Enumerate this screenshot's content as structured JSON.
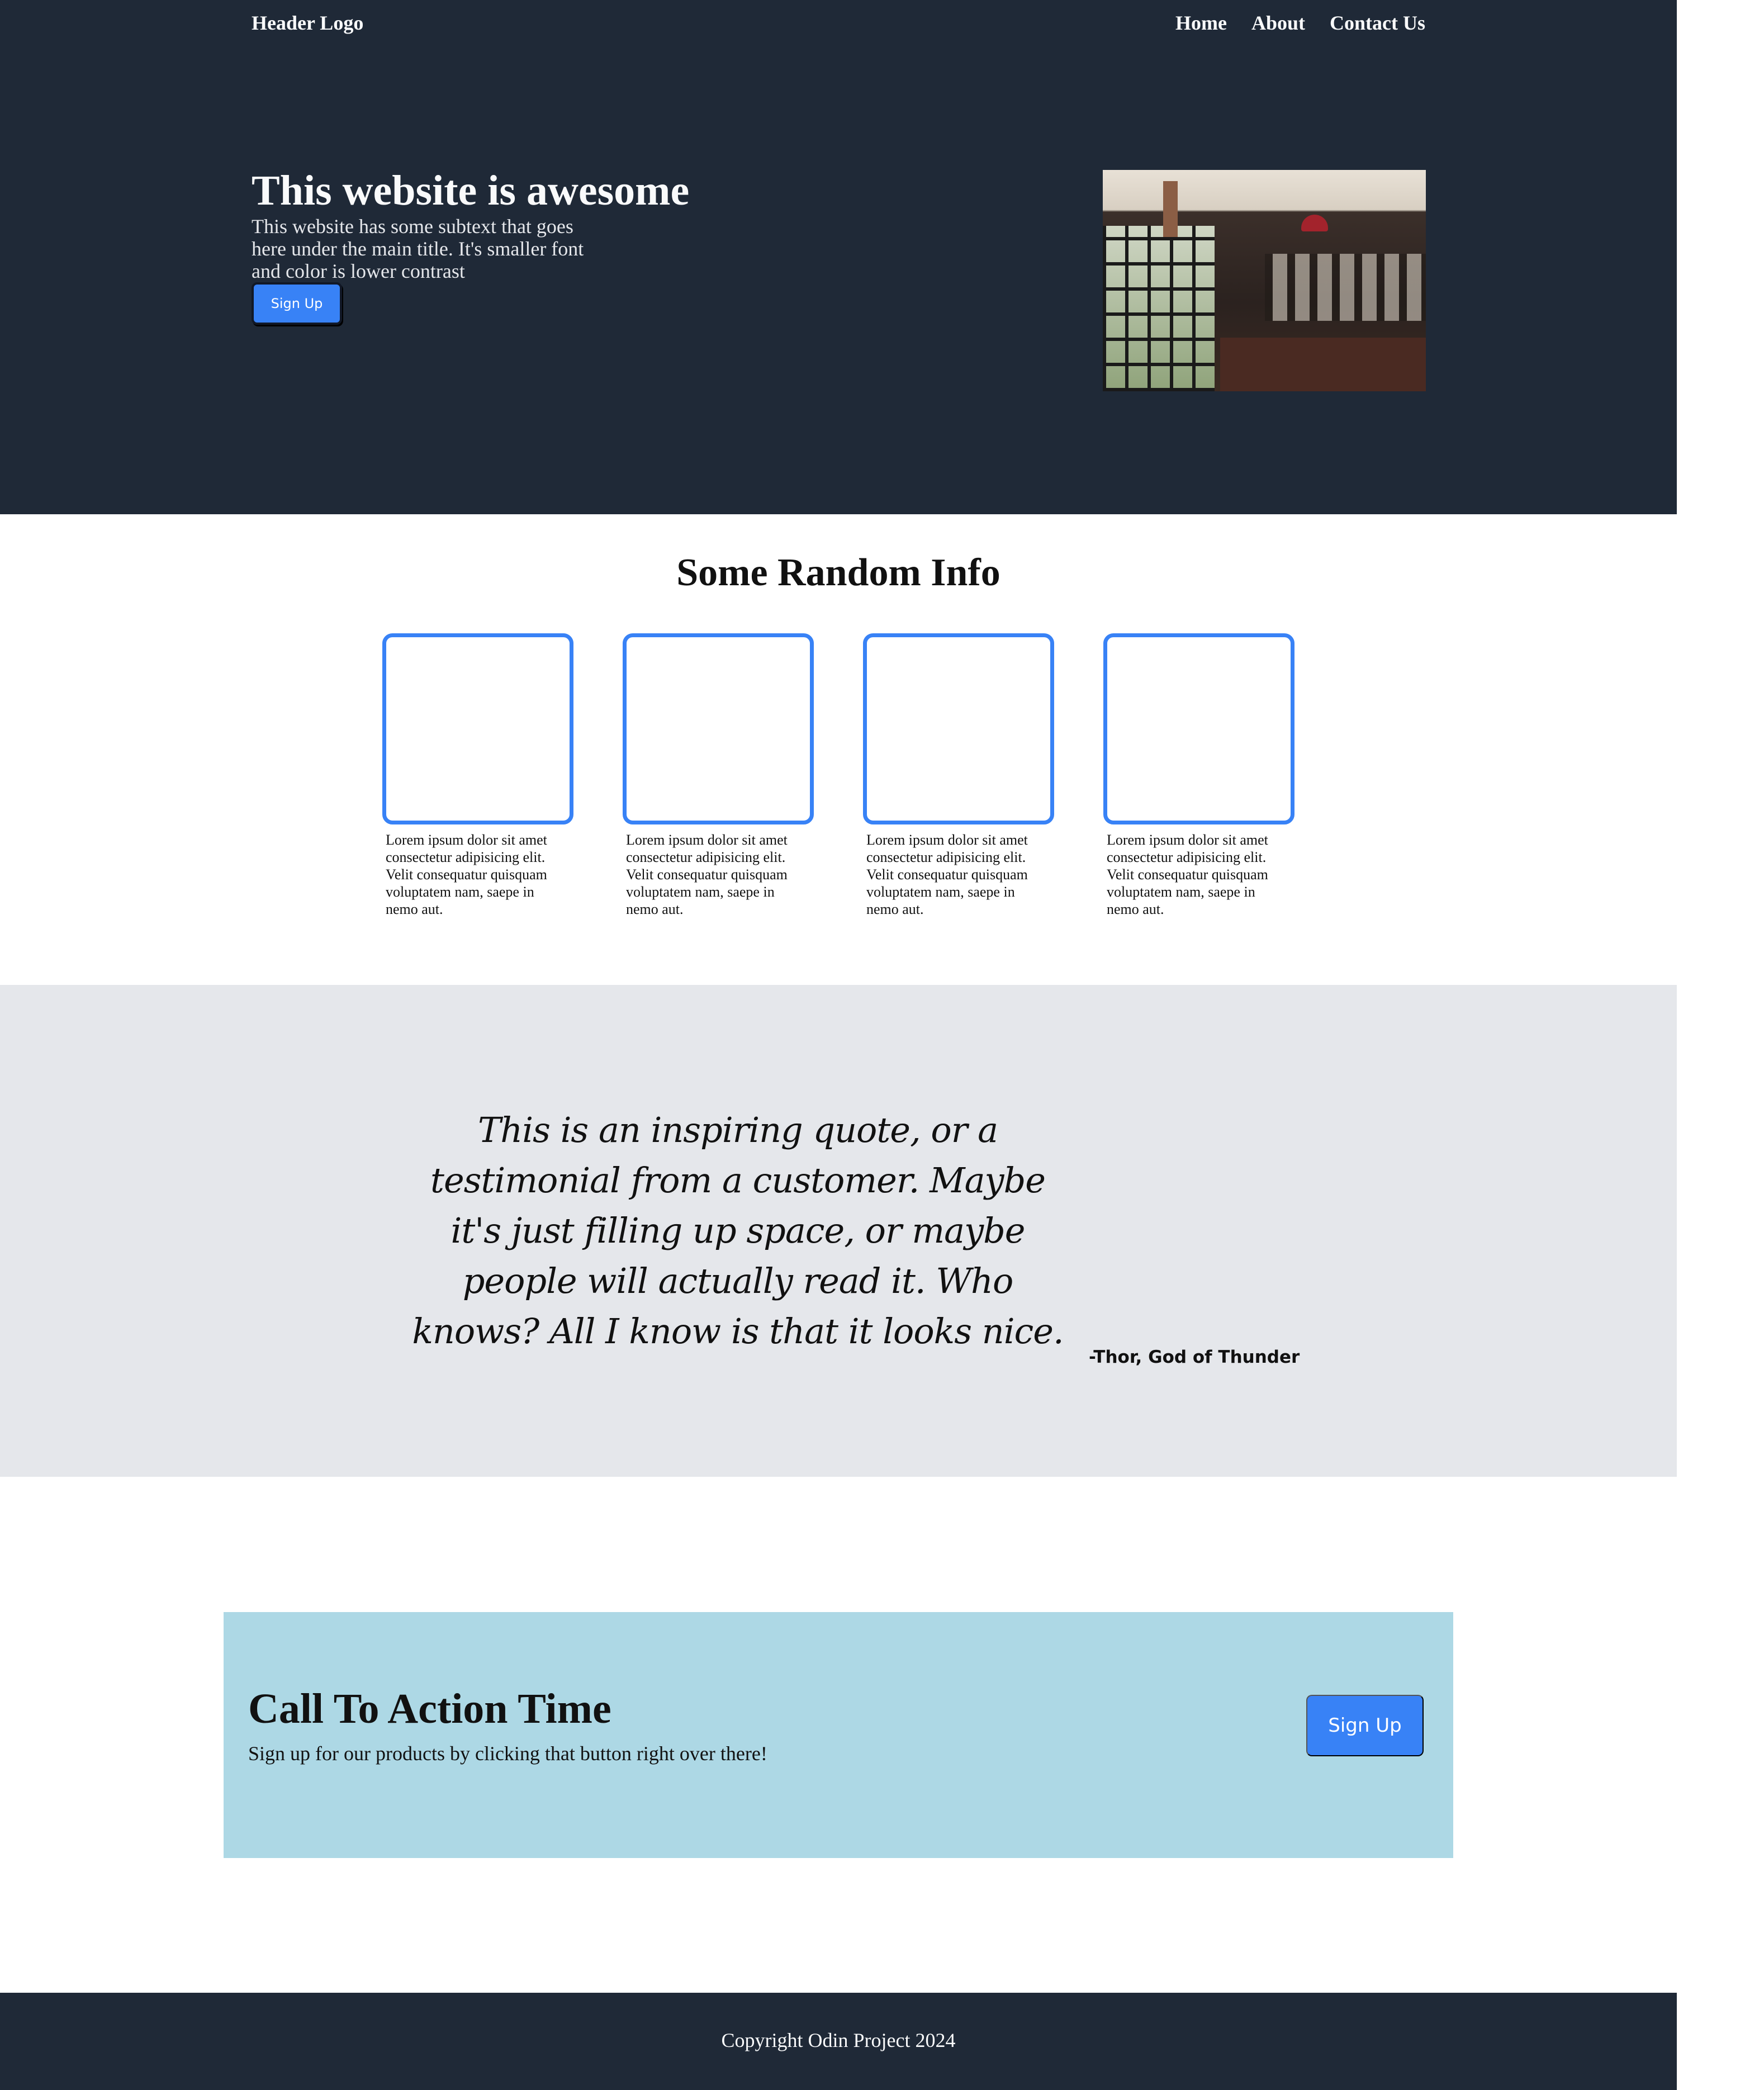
{
  "header": {
    "logo": "Header Logo",
    "nav": [
      "Home",
      "About",
      "Contact Us"
    ]
  },
  "hero": {
    "title": "This website is awesome",
    "subtitle": "This website has some subtext that goes here under the main title. It's smaller font and color is lower contrast",
    "button_label": "Sign Up",
    "image_icon": "cafe-photo"
  },
  "info": {
    "title": "Some Random Info",
    "cards": [
      {
        "text": "Lorem ipsum dolor sit amet consectetur adipisicing elit. Velit consequatur quisquam voluptatem nam, saepe in nemo aut."
      },
      {
        "text": "Lorem ipsum dolor sit amet consectetur adipisicing elit. Velit consequatur quisquam voluptatem nam, saepe in nemo aut."
      },
      {
        "text": "Lorem ipsum dolor sit amet consectetur adipisicing elit. Velit consequatur quisquam voluptatem nam, saepe in nemo aut."
      },
      {
        "text": "Lorem ipsum dolor sit amet consectetur adipisicing elit. Velit consequatur quisquam voluptatem nam, saepe in nemo aut."
      }
    ]
  },
  "quote": {
    "text": "This is an inspiring quote, or a testimonial from a customer. Maybe it's just filling up space, or maybe people will actually read it. Who knows? All I know is that it looks nice.",
    "author": "-Thor, God of Thunder"
  },
  "cta": {
    "title": "Call To Action Time",
    "subtitle": "Sign up for our products by clicking that button right over there!",
    "button_label": "Sign Up"
  },
  "footer": {
    "text": "Copyright Odin Project 2024"
  },
  "colors": {
    "dark": "#1f2937",
    "accent": "#3882f6",
    "quote_bg": "#e5e7eb",
    "cta_bg": "#add8e5"
  }
}
